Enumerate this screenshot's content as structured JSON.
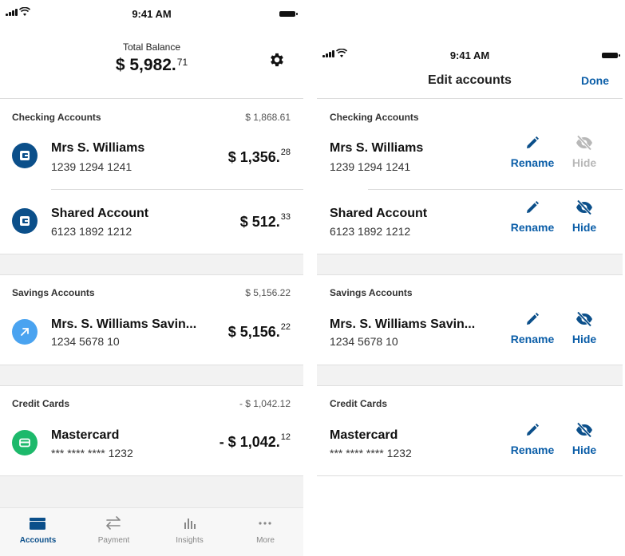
{
  "status_bar": {
    "time": "9:41 AM"
  },
  "left_screen": {
    "total_balance_label": "Total Balance",
    "total_balance_main": "$ 5,982.",
    "total_balance_cents": "71",
    "settings_icon": "gear-icon",
    "sections": [
      {
        "title": "Checking Accounts",
        "total": "$ 1,868.61",
        "accounts": [
          {
            "name": "Mrs S. Williams",
            "number": "1239 1294 1241",
            "amount_main": "$ 1,356.",
            "amount_cents": "28",
            "icon": "bank-card-icon",
            "icon_color": "#0b4f8a"
          },
          {
            "name": "Shared Account",
            "number": "6123 1892 1212",
            "amount_main": "$ 512.",
            "amount_cents": "33",
            "icon": "bank-card-icon",
            "icon_color": "#0b4f8a"
          }
        ]
      },
      {
        "title": "Savings Accounts",
        "total": "$ 5,156.22",
        "accounts": [
          {
            "name": "Mrs. S. Williams Savin...",
            "number": "1234 5678 10",
            "amount_main": "$ 5,156.",
            "amount_cents": "22",
            "icon": "arrow-up-right-icon",
            "icon_color": "#4aa3f0"
          }
        ]
      },
      {
        "title": "Credit Cards",
        "total": "- $ 1,042.12",
        "accounts": [
          {
            "name": "Mastercard",
            "number": "*** **** **** 1232",
            "amount_main": "- $ 1,042.",
            "amount_cents": "12",
            "icon": "credit-card-icon",
            "icon_color": "#1db96b"
          }
        ]
      }
    ],
    "tabs": [
      {
        "label": "Accounts",
        "icon": "wallet-icon",
        "active": true
      },
      {
        "label": "Payment",
        "icon": "transfer-arrows-icon",
        "active": false
      },
      {
        "label": "Insights",
        "icon": "bar-chart-icon",
        "active": false
      },
      {
        "label": "More",
        "icon": "more-dots-icon",
        "active": false
      }
    ]
  },
  "right_screen": {
    "title": "Edit accounts",
    "done_label": "Done",
    "rename_label": "Rename",
    "hide_label": "Hide",
    "sections": [
      {
        "title": "Checking Accounts",
        "accounts": [
          {
            "name": "Mrs S. Williams",
            "number": "1239 1294 1241",
            "hide_enabled": false
          },
          {
            "name": "Shared Account",
            "number": "6123 1892 1212",
            "hide_enabled": true
          }
        ]
      },
      {
        "title": "Savings Accounts",
        "accounts": [
          {
            "name": "Mrs. S. Williams Savin...",
            "number": "1234 5678 10",
            "hide_enabled": true
          }
        ]
      },
      {
        "title": "Credit Cards",
        "accounts": [
          {
            "name": "Mastercard",
            "number": "*** **** **** 1232",
            "hide_enabled": true
          }
        ]
      }
    ]
  },
  "colors": {
    "primary": "#0b5ea8",
    "dark_blue": "#0b4f8a",
    "disabled": "#b8b8b8",
    "savings_icon": "#4aa3f0",
    "credit_icon": "#1db96b"
  }
}
